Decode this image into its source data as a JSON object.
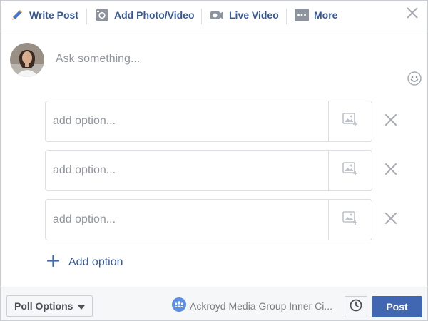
{
  "tabs": [
    {
      "label": "Write Post",
      "icon": "pencil-icon"
    },
    {
      "label": "Add Photo/Video",
      "icon": "camera-icon"
    },
    {
      "label": "Live Video",
      "icon": "video-camera-icon"
    },
    {
      "label": "More",
      "icon": "more-icon"
    }
  ],
  "composer": {
    "placeholder": "Ask something..."
  },
  "poll": {
    "options": [
      {
        "placeholder": "add option..."
      },
      {
        "placeholder": "add option..."
      },
      {
        "placeholder": "add option..."
      }
    ],
    "add_option_label": "Add option"
  },
  "footer": {
    "poll_options_label": "Poll Options",
    "audience_name": "Ackroyd Media Group Inner Ci...",
    "post_label": "Post"
  },
  "colors": {
    "link_blue": "#365899",
    "post_button": "#4267b2",
    "placeholder_gray": "#90949c",
    "border": "#dddfe2",
    "footer_bg": "#f6f7f9"
  }
}
